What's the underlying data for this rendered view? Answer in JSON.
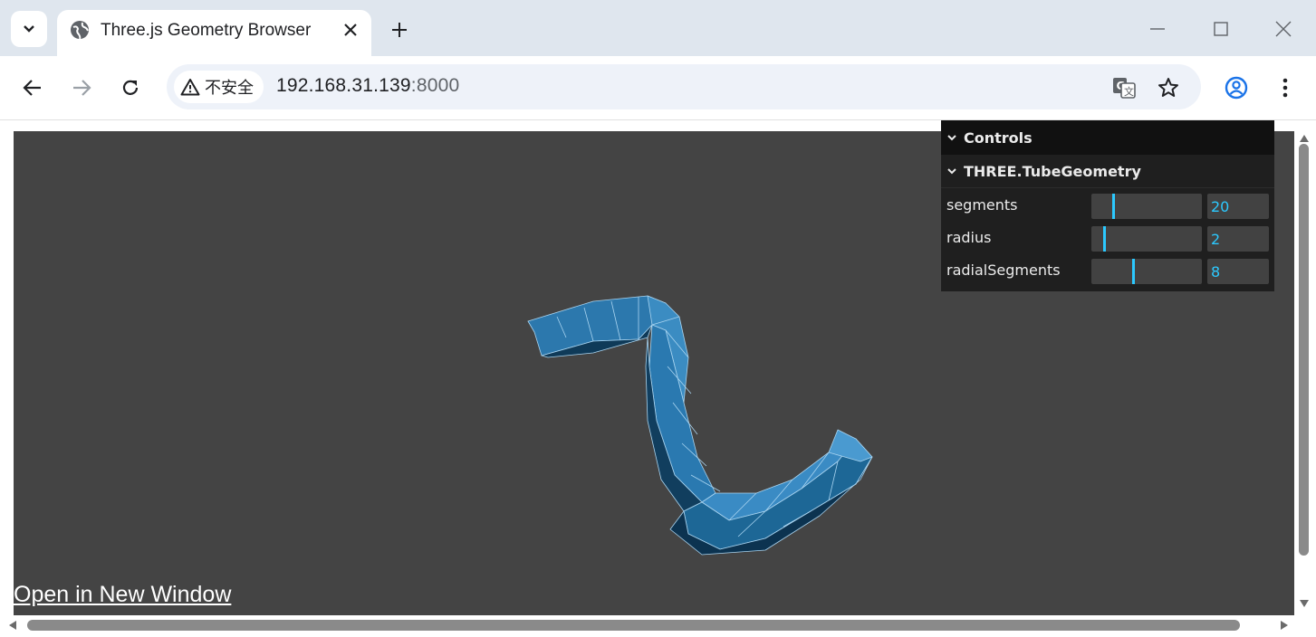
{
  "browser": {
    "tab_title": "Three.js Geometry Browser",
    "security_label": "不安全",
    "url_host": "192.168.31.139",
    "url_port": ":8000"
  },
  "page": {
    "open_link": "Open in New Window"
  },
  "gui": {
    "title": "Controls",
    "folder": "THREE.TubeGeometry",
    "params": [
      {
        "label": "segments",
        "value": "20",
        "fraction": 0.19
      },
      {
        "label": "radius",
        "value": "2",
        "fraction": 0.11
      },
      {
        "label": "radialSegments",
        "value": "8",
        "fraction": 0.37
      }
    ]
  },
  "colors": {
    "canvas_bg": "#444444",
    "tube_light": "#2f7fb7",
    "tube_dark": "#0e3a57",
    "wire": "#a9d4f0",
    "gui_accent": "#2cc9ff"
  }
}
